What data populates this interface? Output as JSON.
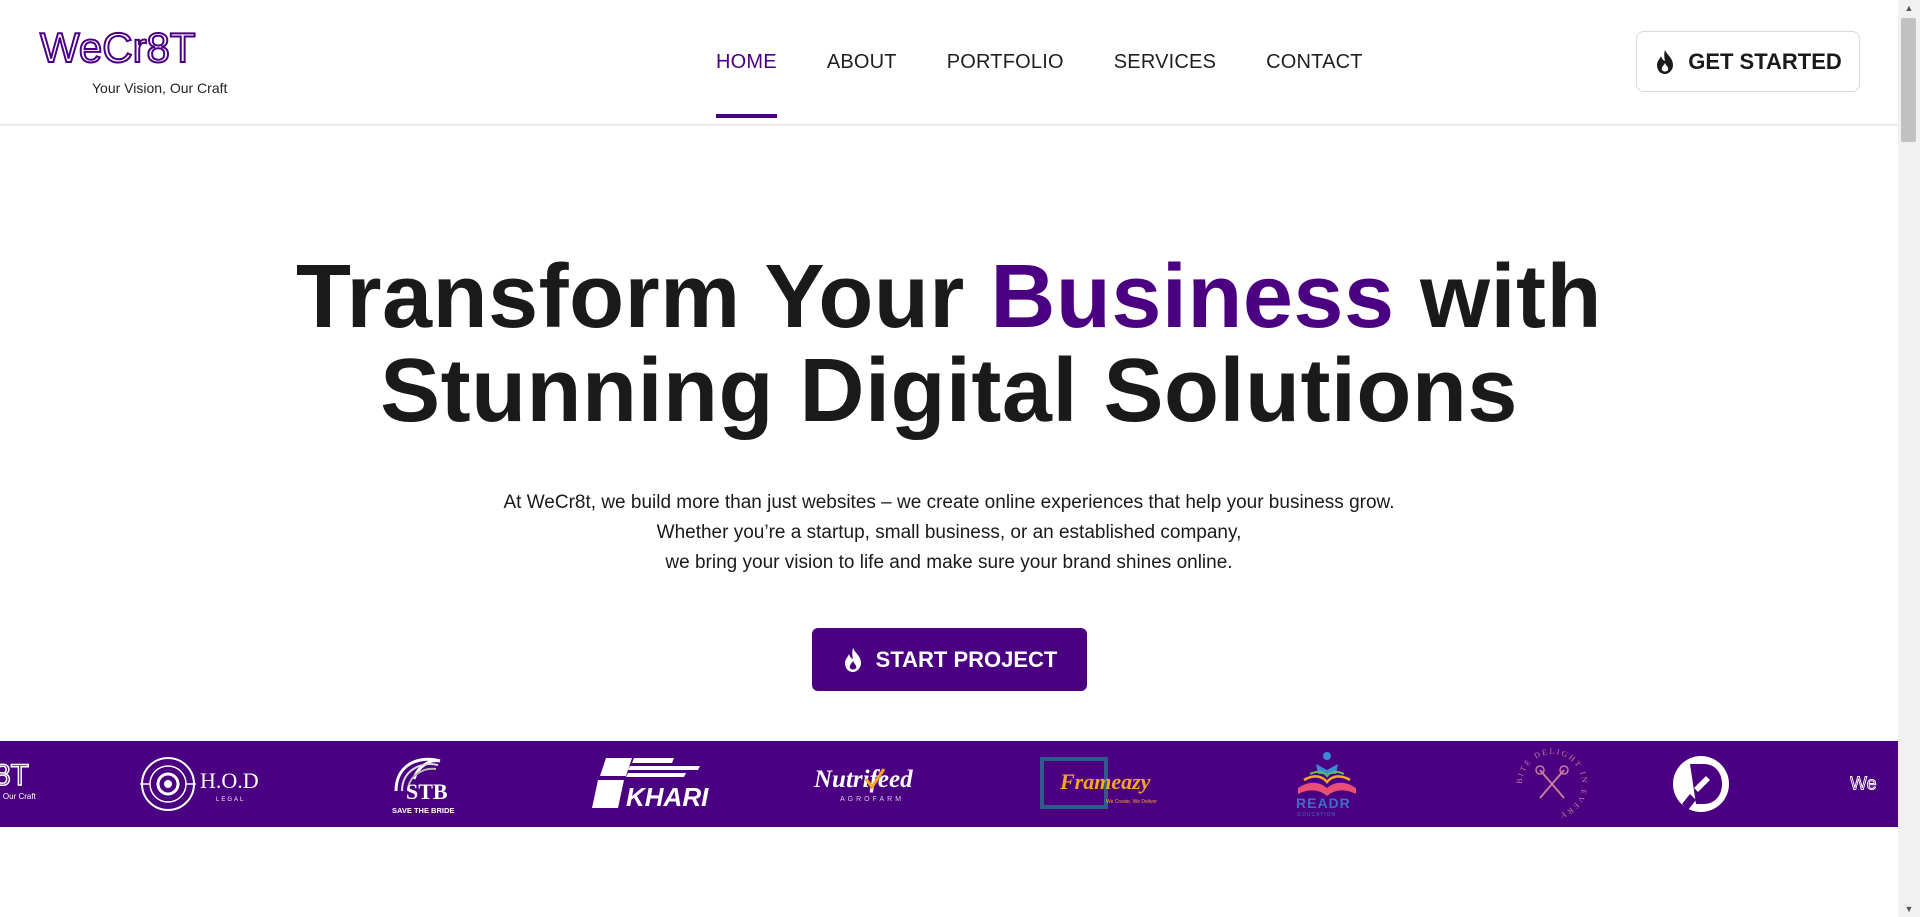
{
  "colors": {
    "brand": "#4b0082",
    "text": "#1a1a1a",
    "white": "#ffffff"
  },
  "header": {
    "logo_text": "WeCr8T",
    "tagline": "Your Vision, Our Craft",
    "nav": [
      {
        "label": "HOME",
        "active": true
      },
      {
        "label": "ABOUT",
        "active": false
      },
      {
        "label": "PORTFOLIO",
        "active": false
      },
      {
        "label": "SERVICES",
        "active": false
      },
      {
        "label": "CONTACT",
        "active": false
      }
    ],
    "cta_label": "GET STARTED",
    "cta_icon": "flame-icon"
  },
  "hero": {
    "title_part1": "Transform Your ",
    "title_accent": "Business",
    "title_part2": " with",
    "title_line2": "Stunning Digital Solutions",
    "subtitle_lines": [
      "At WeCr8t, we build more than just websites – we create online experiences that help your business grow.",
      "Whether you’re a startup, small business, or an established company,",
      "we bring your vision to life and make sure your brand shines online."
    ],
    "button_label": "START PROJECT",
    "button_icon": "flame-icon"
  },
  "clients": {
    "partial_left_text": "8T",
    "partial_left_sub": "n, Our Craft",
    "hod_text": "H.O.D",
    "hod_sub": "LEGAL",
    "stb_text": "STB",
    "stb_sub": "SAVE THE BRIDE",
    "khari_text": "KHARI",
    "nutrifeed_text": "Nutrifeed",
    "nutrifeed_sub": "AGROFARM",
    "frameazy_text": "Frameazy",
    "frameazy_sub": "We Create, We Deliver",
    "readr_text": "READR",
    "readr_sub": "EDUCATION",
    "bite_text": "BITE DELIGHT IN EVERY",
    "d_letter": "D",
    "partial_right_text": "We"
  }
}
